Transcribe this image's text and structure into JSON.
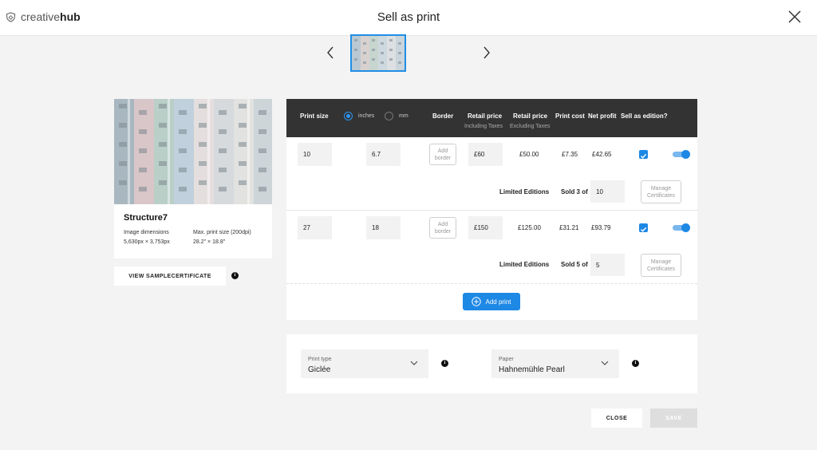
{
  "header": {
    "logo_light": "creative",
    "logo_bold": "hub",
    "title": "Sell as print"
  },
  "artwork": {
    "name": "Structure7",
    "dimensions_label": "Image dimensions",
    "dimensions_value": "5,630px × 3,753px",
    "max_size_label": "Max. print size (200dpi)",
    "max_size_value": "28.2\" × 18.8\"",
    "certificate_button": "VIEW SAMPLECERTIFICATE"
  },
  "table": {
    "headers": {
      "print_size": "Print size",
      "unit_inches": "inches",
      "unit_mm": "mm",
      "selected_unit": "inches",
      "border": "Border",
      "retail_incl": "Retail price",
      "retail_incl_sub": "Including Taxes",
      "retail_excl": "Retail price",
      "retail_excl_sub": "Excluding Taxes",
      "print_cost": "Print cost",
      "net_profit": "Net profit",
      "sell_edition": "Sell as edition?"
    },
    "rows": [
      {
        "width": "10",
        "height": "6.7",
        "border_button": "Add border",
        "retail_incl": "£60",
        "retail_excl": "£50.00",
        "print_cost": "£7.35",
        "net_profit": "£42.65",
        "edition_checked": true,
        "edition_toggle_on": true,
        "limited_label": "Limited Editions",
        "sold_label": "Sold 3 of",
        "edition_size": "10",
        "manage_button": "Manage Certificates"
      },
      {
        "width": "27",
        "height": "18",
        "border_button": "Add border",
        "retail_incl": "£150",
        "retail_excl": "£125.00",
        "print_cost": "£31.21",
        "net_profit": "£93.79",
        "edition_checked": true,
        "edition_toggle_on": true,
        "limited_label": "Limited Editions",
        "sold_label": "Sold 5 of",
        "edition_size": "5",
        "manage_button": "Manage Certificates"
      }
    ],
    "add_print_button": "Add print"
  },
  "options": {
    "print_type_label": "Print type",
    "print_type_value": "Giclée",
    "paper_label": "Paper",
    "paper_value": "Hahnemühle Pearl"
  },
  "footer": {
    "close_button": "CLOSE",
    "save_button": "SAVE"
  },
  "colors": {
    "accent": "#1e88e5",
    "table_header": "#333333",
    "background": "#f3f3f3"
  }
}
